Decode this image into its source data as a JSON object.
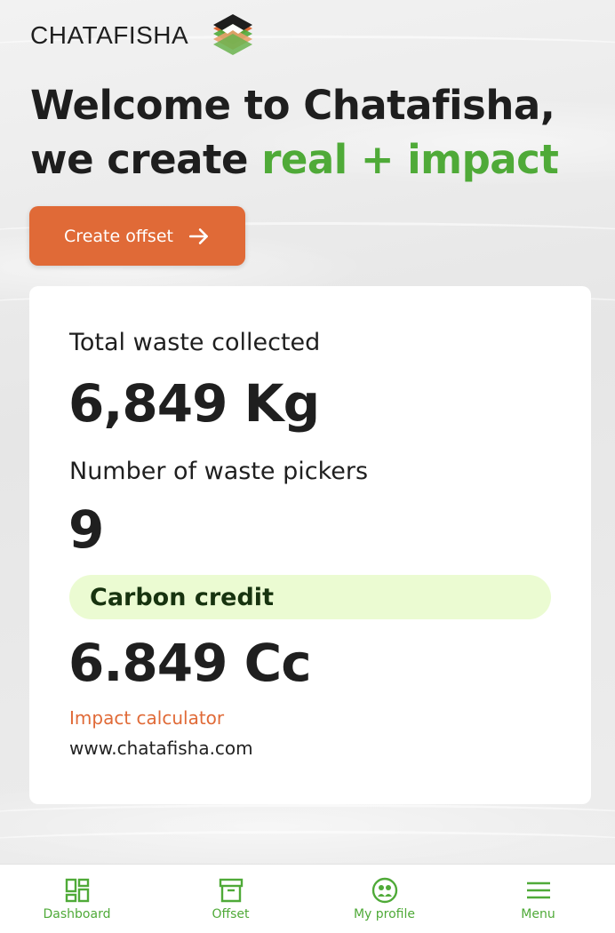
{
  "brand": {
    "name": "CHATAFISHA"
  },
  "hero": {
    "line1": "Welcome to Chatafisha,",
    "line2_prefix": "we create ",
    "line2_accent": "real + impact"
  },
  "cta": {
    "label": "Create offset"
  },
  "stats": {
    "waste_label": "Total waste collected",
    "waste_value": "6,849 Kg",
    "pickers_label": "Number of waste pickers",
    "pickers_value": "9",
    "carbon_label": "Carbon credit",
    "carbon_value": "6.849 Cc",
    "calculator_link": "Impact calculator",
    "website": "www.chatafisha.com"
  },
  "nav": {
    "items": [
      {
        "label": "Dashboard",
        "icon": "dashboard-icon"
      },
      {
        "label": "Offset",
        "icon": "archive-box-icon"
      },
      {
        "label": "My profile",
        "icon": "profile-icon"
      },
      {
        "label": "Menu",
        "icon": "menu-icon"
      }
    ]
  },
  "colors": {
    "accent_green": "#4faa38",
    "accent_orange": "#e06a37",
    "pill_bg": "#ebfbd2"
  }
}
